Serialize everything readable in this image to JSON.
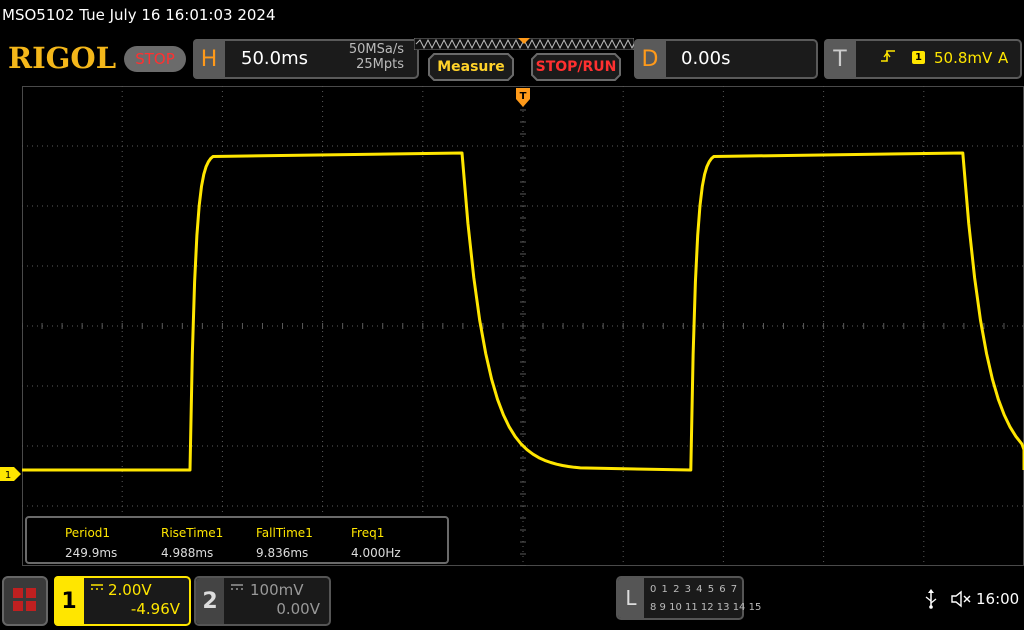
{
  "title": "MSO5102  Tue July 16 16:01:03 2024",
  "brand": "RIGOL",
  "status": "STOP",
  "horizontal": {
    "letter": "H",
    "timebase": "50.0ms",
    "sample_rate": "50MSa/s",
    "memory_depth": "25Mpts"
  },
  "buttons": {
    "measure": "Measure",
    "stop_run": "STOP/RUN"
  },
  "delay": {
    "letter": "D",
    "value": "0.00s"
  },
  "trigger": {
    "letter": "T",
    "edge_icon": "rising-edge-icon",
    "source": "1",
    "level": "50.8mV",
    "mode": "A"
  },
  "channel1": {
    "number": "1",
    "coupling_icon": "dc-coupling-icon",
    "scale": "2.00V",
    "offset": "-4.96V",
    "color": "#ffe600"
  },
  "channel2": {
    "number": "2",
    "coupling_icon": "dc-coupling-icon",
    "scale": "100mV",
    "offset": "0.00V"
  },
  "logic": {
    "letter": "L",
    "row1": "0 1 2 3  4 5 6 7",
    "row2": "8 9 10 11 12 13 14 15"
  },
  "ch1_ground_marker": "1",
  "measurements": [
    {
      "name": "Period1",
      "value": "249.9ms"
    },
    {
      "name": "RiseTime1",
      "value": "4.988ms"
    },
    {
      "name": "FallTime1",
      "value": "9.836ms"
    },
    {
      "name": "Freq1",
      "value": "4.000Hz"
    }
  ],
  "clock": "16:00",
  "colors": {
    "trace": "#ffe600",
    "accent_orange": "#ff9a1a",
    "stop_red": "#ff3030",
    "brand": "#f4b71a"
  },
  "waveform": {
    "type": "square-wave",
    "period_ms": 249.9,
    "rise_time_ms": 4.988,
    "fall_time_ms": 9.836,
    "volts_per_div": 2.0,
    "offset_v": -4.96,
    "time_per_div_ms": 50.0
  }
}
